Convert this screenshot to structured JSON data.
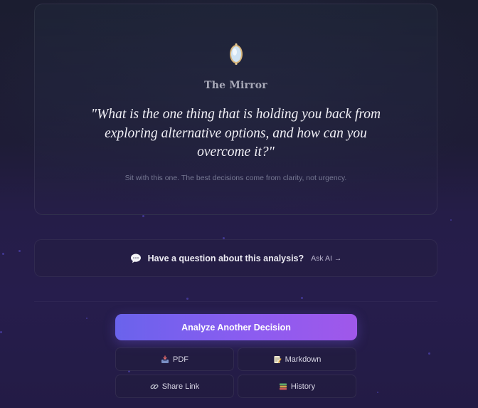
{
  "mirror": {
    "icon": "mirror-icon",
    "title": "The Mirror",
    "quote": "\"What is the one thing that is holding you back from exploring alternative options, and how can you overcome it?\"",
    "subtitle": "Sit with this one. The best decisions come from clarity, not urgency."
  },
  "ask": {
    "icon": "speech-bubble-icon",
    "question": "Have a question about this analysis?",
    "link_label": "Ask AI →"
  },
  "actions": {
    "primary_label": "Analyze Another Decision",
    "pdf": {
      "icon": "inbox-tray-icon",
      "label": "PDF"
    },
    "markdown": {
      "icon": "memo-icon",
      "label": "Markdown"
    },
    "share": {
      "icon": "link-icon",
      "label": "Share Link"
    },
    "history": {
      "icon": "books-icon",
      "label": "History"
    }
  },
  "colors": {
    "accent_start": "#6a63ec",
    "accent_end": "#a058ea",
    "background": "#1f1838"
  }
}
